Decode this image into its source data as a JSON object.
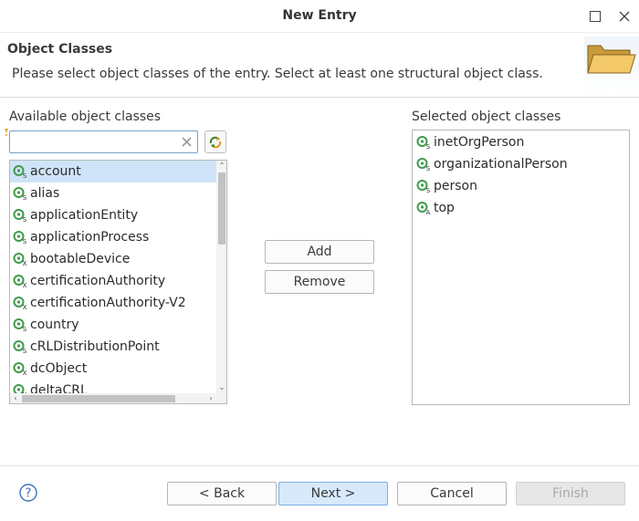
{
  "window": {
    "title": "New Entry"
  },
  "header": {
    "title": "Object Classes",
    "description": "Please select object classes of the entry. Select at least one structural object class."
  },
  "available": {
    "label": "Available object classes",
    "filter_value": "",
    "filter_placeholder": "",
    "items": [
      {
        "label": "account",
        "kind": "S",
        "selected": true
      },
      {
        "label": "alias",
        "kind": "S",
        "selected": false
      },
      {
        "label": "applicationEntity",
        "kind": "S",
        "selected": false
      },
      {
        "label": "applicationProcess",
        "kind": "S",
        "selected": false
      },
      {
        "label": "bootableDevice",
        "kind": "X",
        "selected": false
      },
      {
        "label": "certificationAuthority",
        "kind": "X",
        "selected": false
      },
      {
        "label": "certificationAuthority-V2",
        "kind": "X",
        "selected": false
      },
      {
        "label": "country",
        "kind": "S",
        "selected": false
      },
      {
        "label": "cRLDistributionPoint",
        "kind": "S",
        "selected": false
      },
      {
        "label": "dcObject",
        "kind": "X",
        "selected": false
      },
      {
        "label": "deltaCRL",
        "kind": "X",
        "selected": false
      }
    ]
  },
  "actions": {
    "add_label": "Add",
    "remove_label": "Remove"
  },
  "selected": {
    "label": "Selected object classes",
    "items": [
      {
        "label": "inetOrgPerson",
        "kind": "S"
      },
      {
        "label": "organizationalPerson",
        "kind": "S"
      },
      {
        "label": "person",
        "kind": "S"
      },
      {
        "label": "top",
        "kind": "A"
      }
    ]
  },
  "footer": {
    "back_label": "< Back",
    "next_label": "Next >",
    "cancel_label": "Cancel",
    "finish_label": "Finish"
  },
  "colors": {
    "selection": "#cfe4f8",
    "icon_green": "#3f9b4a",
    "primary_button": "#d7e9fb"
  }
}
